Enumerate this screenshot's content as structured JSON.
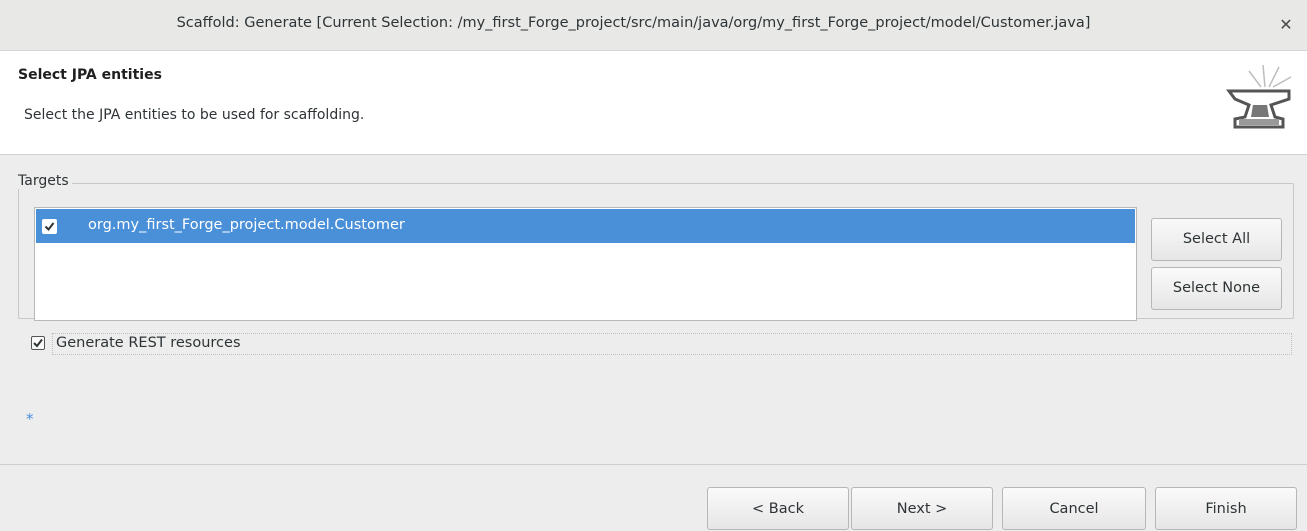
{
  "window": {
    "title": "Scaffold: Generate [Current Selection: /my_first_Forge_project/src/main/java/org/my_first_Forge_project/model/Customer.java]",
    "close_icon": "close-icon"
  },
  "header": {
    "title": "Select JPA entities",
    "description": "Select the JPA entities to be used for scaffolding.",
    "logo_icon": "anvil-icon"
  },
  "targets": {
    "group_label": "Targets",
    "items": [
      {
        "label": "org.my_first_Forge_project.model.Customer",
        "checked": true,
        "selected": true
      }
    ],
    "select_all_label": "Select All",
    "select_none_label": "Select None"
  },
  "options": {
    "generate_rest_label": "Generate REST resources",
    "generate_rest_checked": true
  },
  "required_marker": "*",
  "footer": {
    "back_label": "< Back",
    "next_label": "Next >",
    "cancel_label": "Cancel",
    "finish_label": "Finish"
  },
  "colors": {
    "selection": "#4a90d9",
    "background": "#ededed",
    "header_background": "#ffffff"
  }
}
